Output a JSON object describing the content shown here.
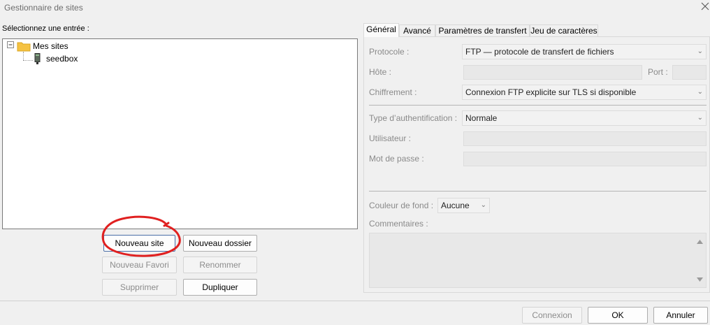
{
  "window": {
    "title": "Gestionnaire de sites"
  },
  "tree": {
    "label": "Sélectionnez une entrée :",
    "root": {
      "label": "Mes sites",
      "toggle": "⊟"
    },
    "child": {
      "label": "seedbox"
    }
  },
  "buttons": {
    "new_site": "Nouveau site",
    "new_folder": "Nouveau dossier",
    "new_bookmark": "Nouveau Favori",
    "rename": "Renommer",
    "delete": "Supprimer",
    "duplicate": "Dupliquer"
  },
  "tabs": [
    "Général",
    "Avancé",
    "Paramètres de transfert",
    "Jeu de caractères"
  ],
  "general": {
    "protocol_label": "Protocole :",
    "protocol_value": "FTP — protocole de transfert de fichiers",
    "host_label": "Hôte :",
    "port_label": "Port :",
    "encryption_label": "Chiffrement :",
    "encryption_value": "Connexion FTP explicite sur TLS si disponible",
    "auth_label": "Type d’authentification :",
    "auth_value": "Normale",
    "user_label": "Utilisateur :",
    "password_label": "Mot de passe :",
    "bg_color_label": "Couleur de fond :",
    "bg_color_value": "Aucune",
    "comments_label": "Commentaires :"
  },
  "footer": {
    "connect": "Connexion",
    "ok": "OK",
    "cancel": "Annuler"
  },
  "colors": {
    "annotation": "#e02020",
    "folder": "#f5c242"
  },
  "icons": {
    "close": "close-icon",
    "folder": "folder-icon",
    "server": "server-icon"
  }
}
